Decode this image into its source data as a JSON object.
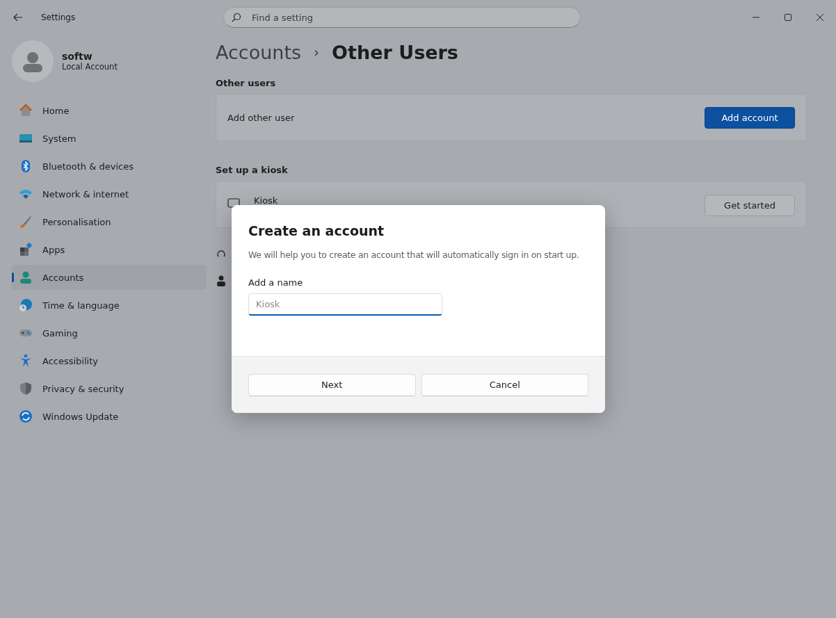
{
  "window": {
    "title": "Settings"
  },
  "search": {
    "placeholder": "Find a setting"
  },
  "profile": {
    "name": "softw",
    "account_type": "Local Account"
  },
  "nav": [
    {
      "label": "Home",
      "selected": false
    },
    {
      "label": "System",
      "selected": false
    },
    {
      "label": "Bluetooth & devices",
      "selected": false
    },
    {
      "label": "Network & internet",
      "selected": false
    },
    {
      "label": "Personalisation",
      "selected": false
    },
    {
      "label": "Apps",
      "selected": false
    },
    {
      "label": "Accounts",
      "selected": true
    },
    {
      "label": "Time & language",
      "selected": false
    },
    {
      "label": "Gaming",
      "selected": false
    },
    {
      "label": "Accessibility",
      "selected": false
    },
    {
      "label": "Privacy & security",
      "selected": false
    },
    {
      "label": "Windows Update",
      "selected": false
    }
  ],
  "breadcrumb": {
    "parent": "Accounts",
    "separator": "›",
    "current": "Other Users"
  },
  "sections": [
    {
      "title": "Other users",
      "row": {
        "label": "Add other user",
        "button": "Add account",
        "primary": true
      }
    },
    {
      "title": "Set up a kiosk",
      "row": {
        "label": "Kiosk",
        "button": "Get started",
        "primary": false
      }
    }
  ],
  "dialog": {
    "title": "Create an account",
    "description": "We will help you to create an account that will automatically sign in on start up.",
    "field_label": "Add a name",
    "field": {
      "placeholder": "Kiosk"
    },
    "buttons": [
      "Next",
      "Cancel"
    ]
  }
}
